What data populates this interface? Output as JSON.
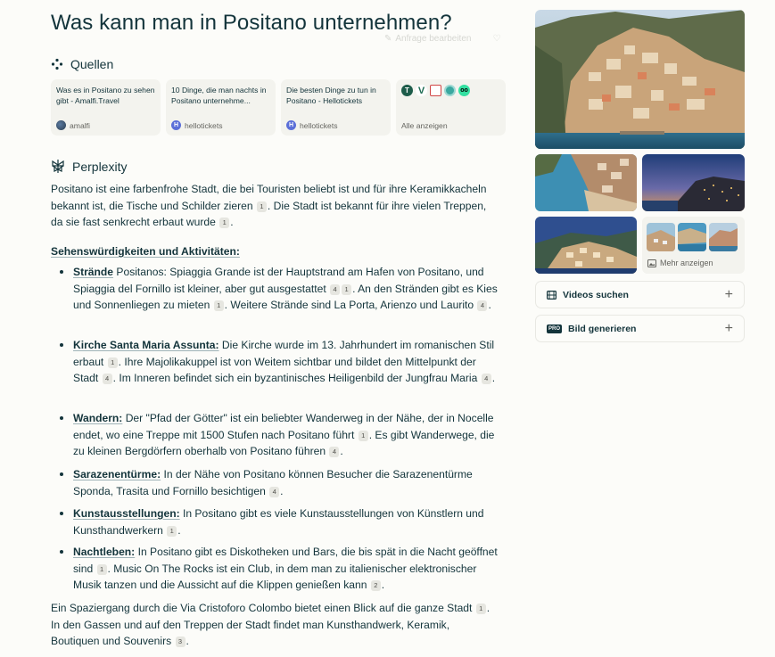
{
  "query": {
    "title": "Was kann man in Positano unternehmen?",
    "edit_label": "Anfrage bearbeiten"
  },
  "sources": {
    "heading": "Quellen",
    "cards": [
      {
        "title": "Was es in Positano zu sehen gibt - Amalfi.Travel",
        "domain": "amalfi",
        "favicon": "globe-icon"
      },
      {
        "title": "10 Dinge, die man nachts in Positano unternehme...",
        "domain": "hellotickets",
        "favicon": "H"
      },
      {
        "title": "Die besten Dinge zu tun in Positano - Hellotickets",
        "domain": "hellotickets",
        "favicon": "H"
      }
    ],
    "more_label": "Alle anzeigen",
    "more_icons": [
      "T",
      "V",
      "book",
      "circle",
      "owl"
    ]
  },
  "answer": {
    "heading": "Perplexity",
    "intro": [
      "Positano ist eine farbenfrohe Stadt, die bei Touristen beliebt ist und für ihre Keramikkacheln bekannt ist, die Tische und Schilder zieren ",
      "1",
      ". Die Stadt ist bekannt für ihre vielen Treppen, da sie fast senkrecht erbaut wurde ",
      "1",
      "."
    ],
    "subheading": "Sehenswürdigkeiten und Aktivitäten:",
    "items": [
      {
        "term": "Strände",
        "text": [
          "Positanos: Spiaggia Grande ist der Hauptstrand am Hafen von Positano, und Spiaggia del Fornillo ist kleiner, aber gut ausgestattet ",
          "4",
          "1",
          ". An den Stränden gibt es Kies und Sonnenliegen zu mieten ",
          "1",
          ". Weitere Strände sind La Porta, Arienzo und Laurito ",
          "4",
          "."
        ]
      },
      {
        "term": "Kirche Santa Maria Assunta:",
        "text": [
          "Die Kirche wurde im 13. Jahrhundert im romanischen Stil erbaut ",
          "1",
          ". Ihre Majolikakuppel ist von Weitem sichtbar und bildet den Mittelpunkt der Stadt ",
          "4",
          ". Im Inneren befindet sich ein byzantinisches Heiligenbild der Jungfrau Maria ",
          "4",
          "."
        ]
      },
      {
        "term": "Wandern:",
        "text": [
          "Der \"Pfad der Götter\" ist ein beliebter Wanderweg in der Nähe, der in Nocelle endet, wo eine Treppe mit 1500 Stufen nach Positano führt ",
          "1",
          ". Es gibt Wanderwege, die zu kleinen Bergdörfern oberhalb von Positano führen ",
          "4",
          "."
        ]
      },
      {
        "term": "Sarazenentürme:",
        "text": [
          "In der Nähe von Positano können Besucher die Sarazenentürme Sponda, Trasita und Fornillo besichtigen ",
          "4",
          "."
        ]
      },
      {
        "term": "Kunstausstellungen:",
        "text": [
          "In Positano gibt es viele Kunstausstellungen von Künstlern und Kunsthandwerkern ",
          "1",
          "."
        ]
      },
      {
        "term": "Nachtleben:",
        "text": [
          "In Positano gibt es Diskotheken und Bars, die bis spät in die Nacht geöffnet sind ",
          "1",
          ". Music On The Rocks ist ein Club, in dem man zu italienischer elektronischer Musik tanzen und die Aussicht auf die Klippen genießen kann ",
          "2",
          "."
        ]
      }
    ],
    "outro": [
      "Ein Spaziergang durch die Via Cristoforo Colombo bietet einen Blick auf die ganze Stadt ",
      "1",
      ". In den Gassen und auf den Treppen der Stadt findet man Kunsthandwerk, Keramik, Boutiquen und Souvenirs ",
      "3",
      "."
    ]
  },
  "sidebar": {
    "more_images_label": "Mehr anzeigen",
    "videos_label": "Videos suchen",
    "generate_label": "Bild generieren",
    "pro_badge": "PRO"
  },
  "colors": {
    "accent": "#20808d",
    "text": "#13343b",
    "background": "#fcfcf9"
  }
}
